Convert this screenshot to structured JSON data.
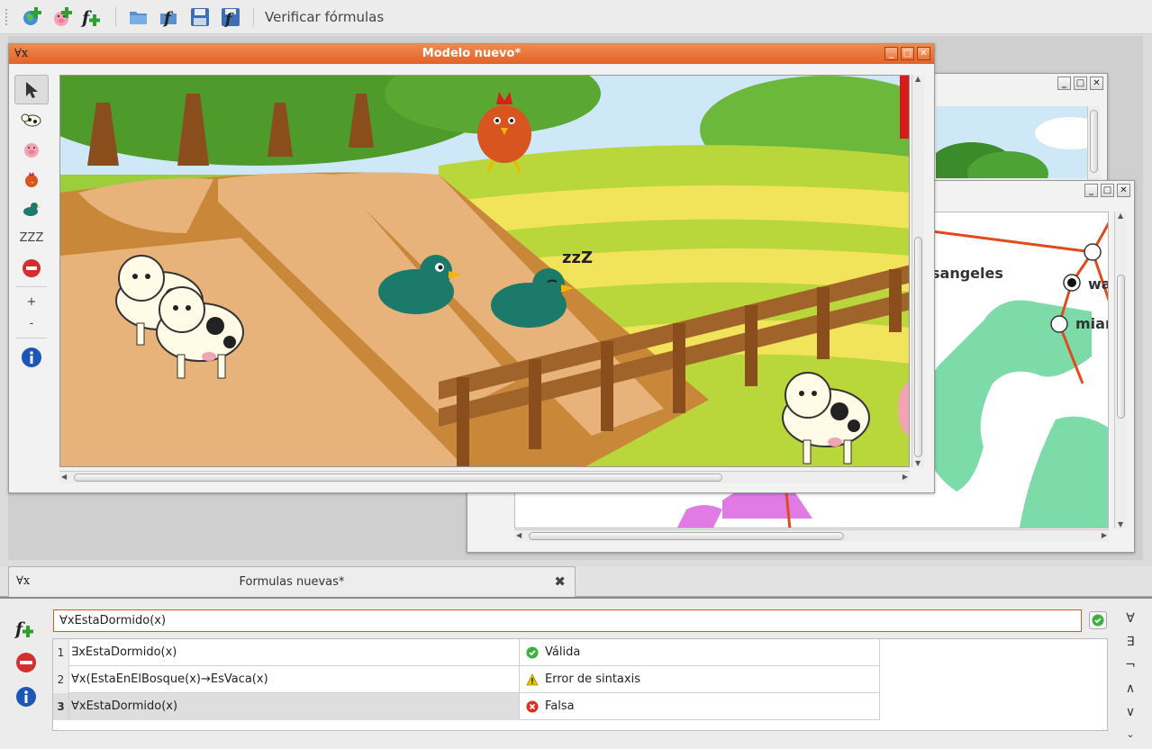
{
  "toolbar": {
    "verify_label": "Verificar fórmulas",
    "icons": [
      "new-world-icon",
      "new-pig-world-icon",
      "new-formula-icon",
      "open-folder-icon",
      "open-formula-icon",
      "save-icon",
      "save-formula-icon"
    ]
  },
  "main_window": {
    "symbol": "∀x",
    "title": "Modelo nuevo*",
    "palette": {
      "sleep_label": "ZZZ",
      "zoom_in": "+",
      "zoom_out": "-"
    },
    "scene_sleep_text": "zzZ"
  },
  "map_window": {
    "cities": [
      "sangeles",
      "wa",
      "mian"
    ]
  },
  "formula_panel": {
    "symbol": "∀x",
    "tab_title": "Formulas nuevas*",
    "close": "✖",
    "input_value": "∀xEstaDormido(x)",
    "rows": [
      {
        "num": "1",
        "expr": "∃xEstaDormido(x)",
        "result": "Válida",
        "status": "valid"
      },
      {
        "num": "2",
        "expr": "∀x(EstaEnElBosque(x)→EsVaca(x)",
        "result": "Error de sintaxis",
        "status": "error"
      },
      {
        "num": "3",
        "expr": "∀xEstaDormido(x)",
        "result": "Falsa",
        "status": "false"
      }
    ],
    "symbols": [
      "∀",
      "∃",
      "¬",
      "∧",
      "∨",
      "⌄"
    ]
  },
  "colors": {
    "accent": "#e8692e",
    "valid": "#3cb043",
    "error": "#e8c400",
    "false": "#d93025"
  }
}
